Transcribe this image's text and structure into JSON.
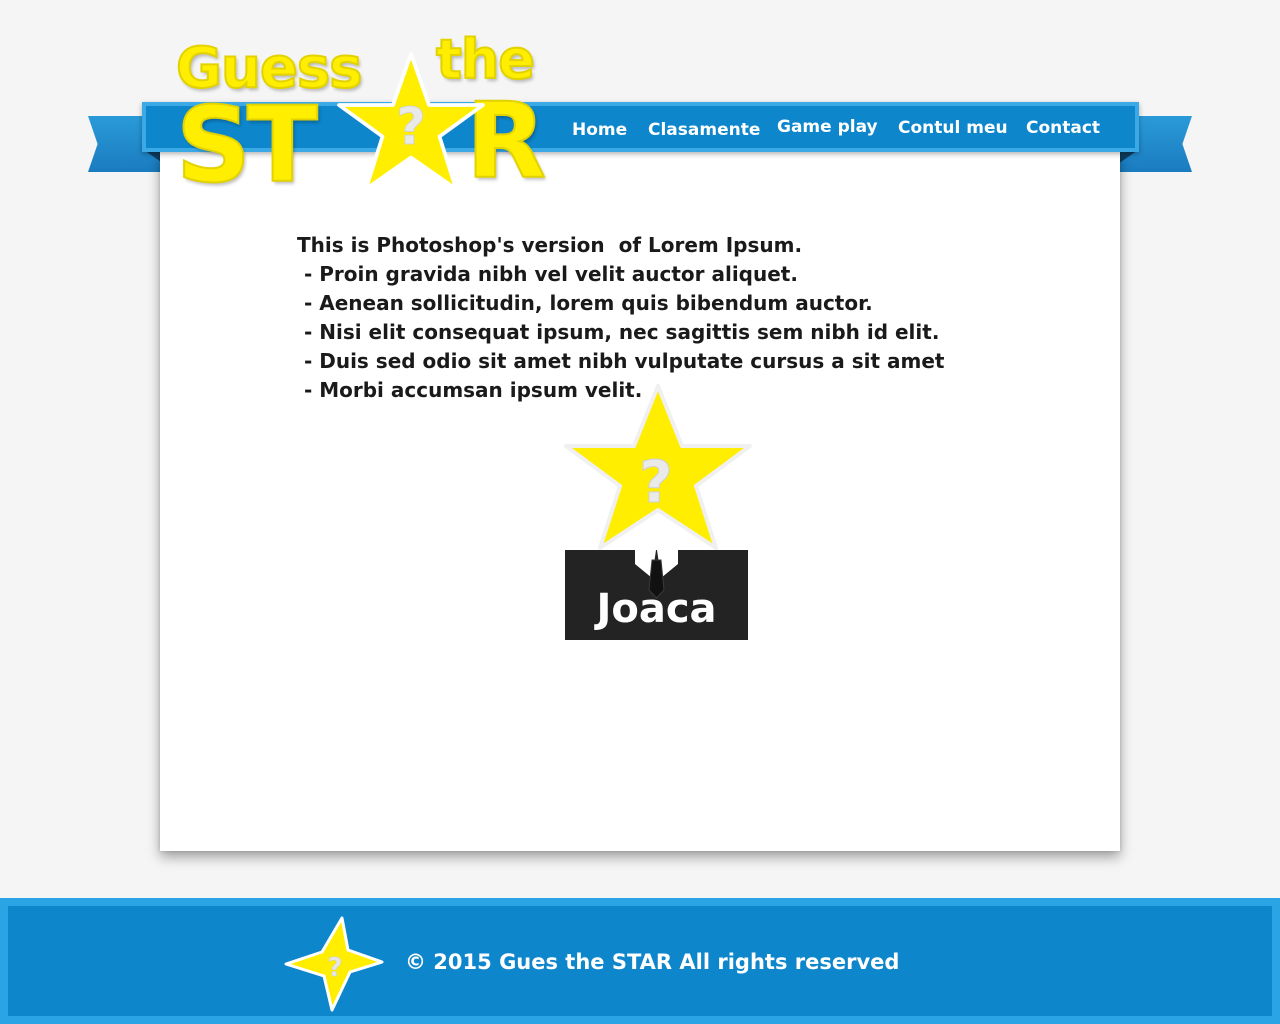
{
  "colors": {
    "page_background": "#f5f5f5",
    "brand_blue": "#0d86cc",
    "brand_blue_light": "#3aa9e6",
    "star_yellow": "#ffee00",
    "suit_dark": "#232323",
    "text_dark": "#1a1a1a"
  },
  "logo": {
    "line1_word1": "Guess",
    "line1_word2": "the",
    "line2_left": "ST",
    "line2_right": "R",
    "star_mark": "?",
    "icon": "star-question-icon"
  },
  "nav": {
    "items": [
      {
        "label": "Home"
      },
      {
        "label": "Clasamente"
      },
      {
        "label": "Game play"
      },
      {
        "label": "Contul meu"
      },
      {
        "label": "Contact"
      }
    ]
  },
  "main": {
    "lines": [
      "This is Photoshop's version  of Lorem Ipsum.",
      " - Proin gravida nibh vel velit auctor aliquet.",
      " - Aenean sollicitudin, lorem quis bibendum auctor.",
      " - Nisi elit consequat ipsum, nec sagittis sem nibh id elit.",
      " - Duis sed odio sit amet nibh vulputate cursus a sit amet",
      " - Morbi accumsan ipsum velit."
    ],
    "play_button": {
      "label": "Joaca",
      "star_mark": "?",
      "icon": "star-head-suit-icon"
    }
  },
  "footer": {
    "text": "© 2015 Gues the STAR All rights reserved",
    "star_mark": "?",
    "icon": "star-question-icon"
  }
}
